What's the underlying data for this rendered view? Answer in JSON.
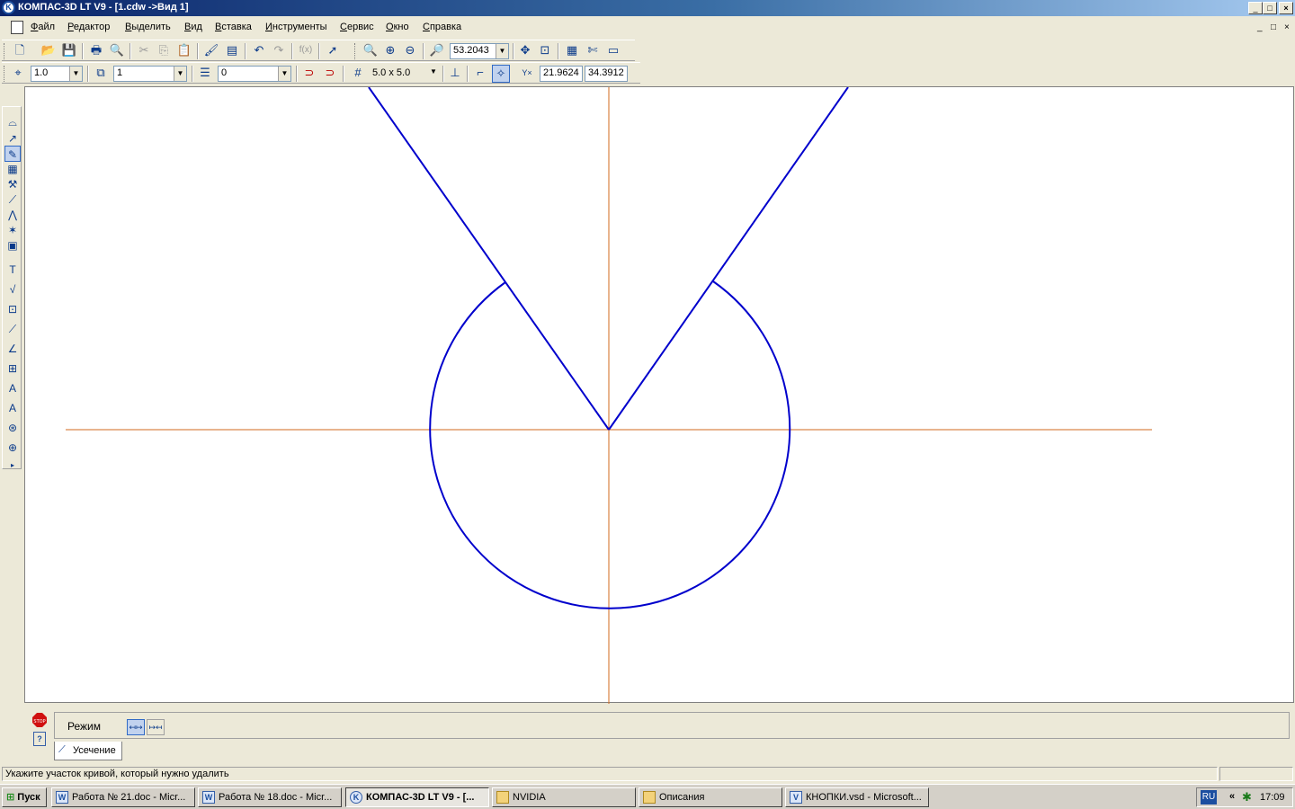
{
  "window": {
    "title": "КОМПАС-3D LT V9 - [1.cdw ->Вид 1]",
    "app_icon": "K",
    "buttons": [
      "_",
      "□",
      "×"
    ]
  },
  "menu": {
    "items": [
      "Файл",
      "Редактор",
      "Выделить",
      "Вид",
      "Вставка",
      "Инструменты",
      "Сервис",
      "Окно",
      "Справка"
    ],
    "mdi_buttons": [
      "_",
      "□",
      "×"
    ]
  },
  "toolbar_standard": {
    "zoom_value": "53.2043"
  },
  "toolbar_current_state": {
    "step_value": "1.0",
    "layer_view": "1",
    "layer": "0",
    "grid": "5.0 x 5.0",
    "coord_x": "21.9624",
    "coord_y": "34.3912"
  },
  "drawing": {
    "geometry_color": "#0000cc",
    "axis_color": "#d2691e"
  },
  "property_panel": {
    "mode_label": "Режим",
    "tab_label": "Усечение",
    "stop_icon_label": "STOP",
    "help_icon_label": "?"
  },
  "status": {
    "message": "Укажите участок кривой, который нужно удалить"
  },
  "taskbar": {
    "start_label": "Пуск",
    "tasks": [
      {
        "label": "Работа № 21.doc - Micr...",
        "icon": "W",
        "active": false
      },
      {
        "label": "Работа № 18.doc - Micr...",
        "icon": "W",
        "active": false
      },
      {
        "label": "КОМПАС-3D LT V9 - [...",
        "icon": "K",
        "active": true
      },
      {
        "label": "NVIDIA",
        "icon": "folder",
        "active": false
      },
      {
        "label": "Описания",
        "icon": "folder",
        "active": false
      },
      {
        "label": "КНОПКИ.vsd - Microsoft...",
        "icon": "V",
        "active": false
      }
    ],
    "tray_lang": "RU",
    "tray_arrows": "«",
    "clock": "17:09"
  }
}
